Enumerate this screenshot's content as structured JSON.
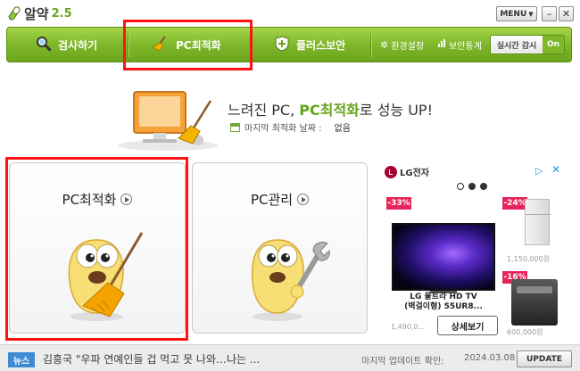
{
  "app": {
    "name": "알약",
    "version": "2.5",
    "menu_label": "MENU",
    "minimize_symbol": "–",
    "close_symbol": "✕"
  },
  "nav": {
    "scan_label": "검사하기",
    "optimize_label": "PC최적화",
    "plus_security_label": "플러스보안",
    "settings_label": "환경설정",
    "security_stats_label": "보안통계",
    "realtime_label": "실시간 감시",
    "realtime_state": "On",
    "highlight_color": "#ff1212"
  },
  "hero": {
    "title_pre": "느려진 PC, ",
    "title_accent": "PC최적화",
    "title_post": "로 성능 UP!",
    "last_optimize_label": "마지막 최적화 날짜 :",
    "last_optimize_value": "없음"
  },
  "cards": {
    "optimize_title": "PC최적화",
    "manage_title": "PC관리"
  },
  "ad": {
    "brand": "LG전자",
    "discount_1": "-33%",
    "discount_2": "-24%",
    "discount_3": "-16%",
    "product_name_line1": "LG 울트라 HD TV",
    "product_name_line2": "(벽걸이형) 55UR8...",
    "product_price": "1,490,0...",
    "fridge_price": "1,150,000원",
    "washer_price": "600,000원",
    "detail_button": "상세보기"
  },
  "bottom": {
    "news_badge": "뉴스",
    "news_headline": "김흥국 \"우파 연예인들 겁 먹고 못 나와…나는 ...",
    "last_update_label": "마지막 업데이트 확인:",
    "last_update_date": "2024.03.08",
    "update_button": "UPDATE"
  }
}
